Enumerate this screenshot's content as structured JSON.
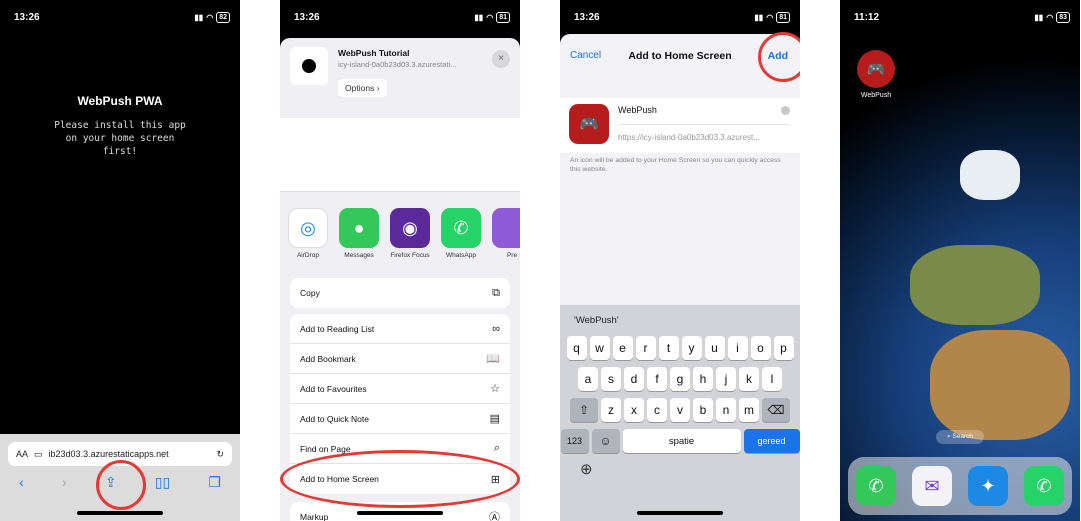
{
  "panel1": {
    "time": "13:26",
    "battery": "82",
    "title": "WebPush PWA",
    "message": "Please install this app on your home screen first!",
    "url_aa": "AA",
    "url": "ib23d03.3.azurestaticapps.net"
  },
  "panel2": {
    "time": "13:26",
    "battery": "81",
    "site_title": "WebPush Tutorial",
    "site_url": "icy-island-0a0b23d03.3.azurestati...",
    "options_label": "Options",
    "apps": [
      "AirDrop",
      "Messages",
      "Firefox Focus",
      "WhatsApp",
      "Pre"
    ],
    "copy_label": "Copy",
    "actions": [
      "Add to Reading List",
      "Add Bookmark",
      "Add to Favourites",
      "Add to Quick Note",
      "Find on Page",
      "Add to Home Screen"
    ],
    "markup_label": "Markup"
  },
  "panel3": {
    "time": "13:26",
    "battery": "81",
    "cancel_label": "Cancel",
    "title": "Add to Home Screen",
    "add_label": "Add",
    "name_value": "WebPush",
    "url": "https://icy-island-0a0b23d03.3.azurest...",
    "hint": "An icon will be added to your Home Screen so you can quickly access this website.",
    "suggestion": "'WebPush'",
    "row1": [
      "q",
      "w",
      "e",
      "r",
      "t",
      "y",
      "u",
      "i",
      "o",
      "p"
    ],
    "row2": [
      "a",
      "s",
      "d",
      "f",
      "g",
      "h",
      "j",
      "k",
      "l"
    ],
    "row3": [
      "z",
      "x",
      "c",
      "v",
      "b",
      "n",
      "m"
    ],
    "num_label": "123",
    "space_label": "spatie",
    "go_label": "gereed"
  },
  "panel4": {
    "time": "11:12",
    "battery": "83",
    "app_label": "WebPush",
    "search_label": "Search"
  }
}
